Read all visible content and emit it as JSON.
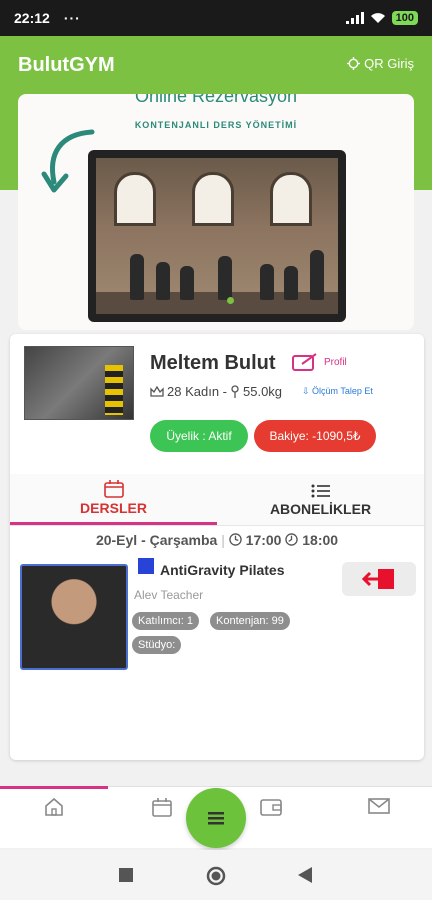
{
  "status_bar": {
    "time": "22:12",
    "dots": "···",
    "battery": "100"
  },
  "app": {
    "title": "BulutGYM",
    "qr_label": "QR Giriş"
  },
  "banner": {
    "title": "Online Rezervasyon",
    "subtitle": "KONTENJANLI DERS YÖNETİMİ"
  },
  "profile": {
    "name": "Meltem Bulut",
    "profile_link": "Profil",
    "meta_age_gender": "28 Kadın -",
    "meta_weight": "55.0kg",
    "measure_link": "Ölçüm Talep Et",
    "membership_status": "Üyelik : Aktif",
    "balance": "Bakiye: -1090,5₺"
  },
  "tabs": [
    {
      "label": "DERSLER",
      "icon": "calendar-icon",
      "active": true
    },
    {
      "label": "ABONELİKLER",
      "icon": "list-icon",
      "active": false
    }
  ],
  "lesson": {
    "date": "20-Eyl - Çarşamba",
    "separator": "|",
    "start_time": "17:00",
    "end_time": "18:00",
    "title": "AntiGravity Pilates",
    "teacher": "Alev Teacher",
    "participants": "Katılımcı: 1",
    "capacity": "Kontenjan: 99",
    "studio": "Stüdyo:",
    "color": "#2743d8"
  },
  "bottom_nav": {
    "items": [
      "home-icon",
      "calendar-icon",
      "menu-icon",
      "wallet-icon",
      "mail-icon"
    ]
  },
  "colors": {
    "brand_green": "#7cc142",
    "accent_pink": "#d63384",
    "status_green": "#3cc454",
    "status_red": "#e53b30"
  }
}
